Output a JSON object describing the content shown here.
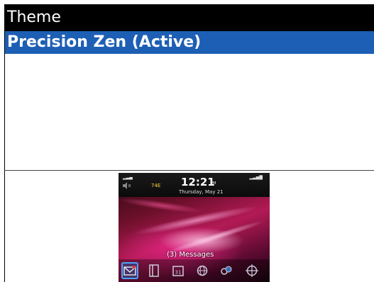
{
  "header": {
    "title": "Theme"
  },
  "themes": {
    "items": [
      {
        "label": "Precision Zen (Active)",
        "selected": true
      }
    ]
  },
  "preview": {
    "carrier": "",
    "time": "12:21",
    "ampm": "PM",
    "date": "Thursday, May 21",
    "battery": "74E",
    "messages": "(3) Messages",
    "dock_icons": [
      "messages-icon",
      "contacts-icon",
      "calendar-icon",
      "browser-icon",
      "media-icon",
      "maps-icon"
    ],
    "colors": {
      "selected_bg": "#1d5fb4",
      "wallpaper": "#b31a55"
    }
  }
}
